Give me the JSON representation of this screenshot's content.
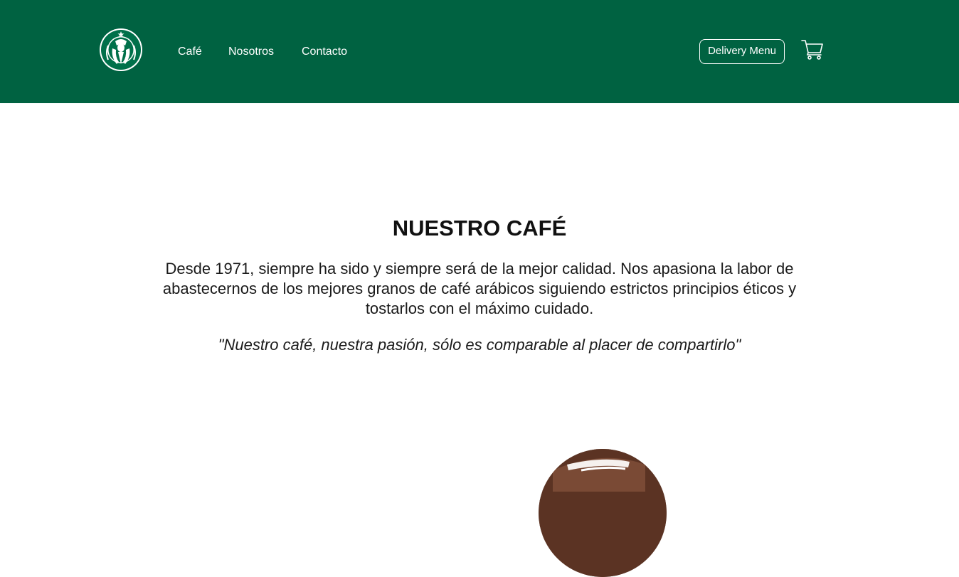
{
  "header": {
    "background_color": "#006241",
    "logo_icon": "starbucks-siren-logo-icon",
    "nav": [
      {
        "label": "Café"
      },
      {
        "label": "Nosotros"
      },
      {
        "label": "Contacto"
      }
    ],
    "delivery_label": "Delivery Menu",
    "cart_icon": "shopping-cart-icon"
  },
  "main": {
    "title": "NUESTRO CAFÉ",
    "description": "Desde 1971, siempre ha sido y siempre será de la mejor calidad. Nos apasiona la labor de abastecernos de los mejores granos de café arábicos siguiendo estrictos principios éticos y tostarlos con el máximo cuidado.",
    "quote": "\"Nuestro café, nuestra pasión, sólo es comparable al placer de compartirlo\""
  },
  "colors": {
    "brand_green": "#006241",
    "text": "#111111",
    "coffee_brown": "#5b3323"
  }
}
